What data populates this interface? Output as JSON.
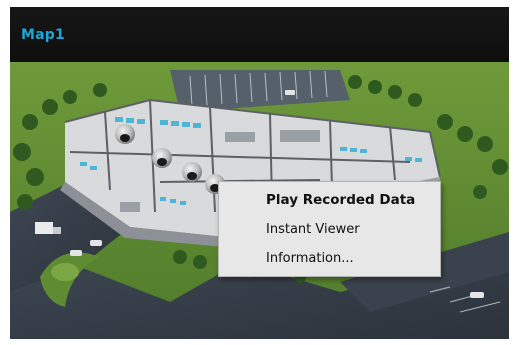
{
  "window": {
    "title": "Map1",
    "accent_color": "#1ba7d8",
    "background_color": "#131313"
  },
  "map": {
    "description_icon": "building-floorplan-map",
    "cameras": [
      "dome-camera",
      "dome-camera",
      "dome-camera",
      "dome-camera"
    ]
  },
  "context_menu": {
    "items": [
      {
        "label": "Play Recorded Data",
        "bold": true
      },
      {
        "label": "Instant Viewer",
        "bold": false
      },
      {
        "label": "Information...",
        "bold": false
      }
    ],
    "background_color": "#e7e7e7"
  }
}
